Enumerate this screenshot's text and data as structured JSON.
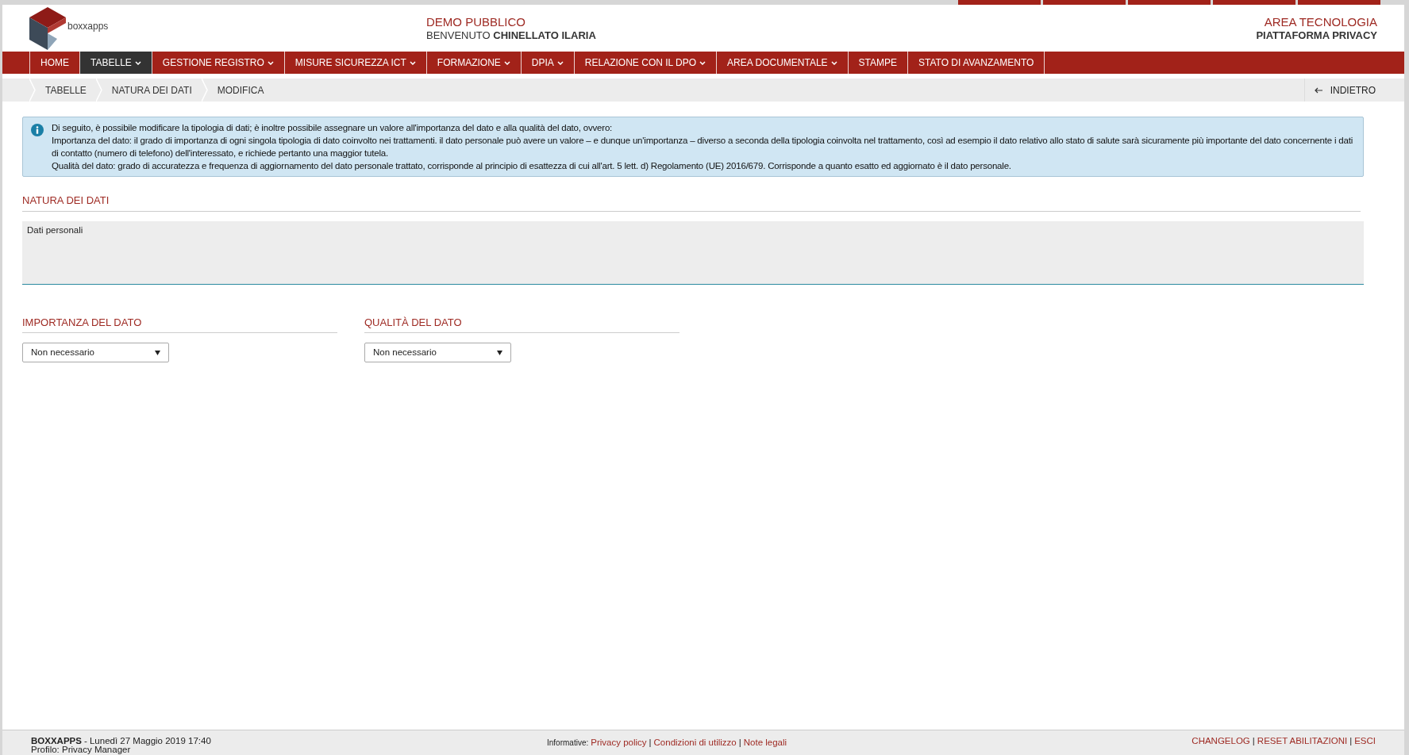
{
  "header": {
    "logo_text": "boxxapps",
    "demo_label": "DEMO PUBBLICO",
    "welcome_prefix": "BENVENUTO",
    "user_name": "CHINELLATO ILARIA",
    "area": "AREA TECNOLOGIA",
    "platform": "PIATTAFORMA PRIVACY"
  },
  "nav": [
    {
      "label": "HOME",
      "has_menu": false,
      "selected": false
    },
    {
      "label": "TABELLE",
      "has_menu": true,
      "selected": true
    },
    {
      "label": "GESTIONE REGISTRO",
      "has_menu": true,
      "selected": false
    },
    {
      "label": "MISURE SICUREZZA ICT",
      "has_menu": true,
      "selected": false
    },
    {
      "label": "FORMAZIONE",
      "has_menu": true,
      "selected": false
    },
    {
      "label": "DPIA",
      "has_menu": true,
      "selected": false
    },
    {
      "label": "RELAZIONE CON IL DPO",
      "has_menu": true,
      "selected": false
    },
    {
      "label": "AREA DOCUMENTALE",
      "has_menu": true,
      "selected": false
    },
    {
      "label": "STAMPE",
      "has_menu": false,
      "selected": false
    },
    {
      "label": "STATO DI AVANZAMENTO",
      "has_menu": false,
      "selected": false
    }
  ],
  "breadcrumb": [
    "TABELLE",
    "NATURA DEI DATI",
    "MODIFICA"
  ],
  "back_button": "INDIETRO",
  "info": [
    "Di seguito, è possibile modificare la tipologia di dati; è inoltre possibile assegnare un valore all'importanza del dato e alla qualità del dato, ovvero:",
    "Importanza del dato: il grado di importanza di ogni singola tipologia di dato coinvolto nei trattamenti.  il dato personale può avere un valore – e dunque un'importanza – diverso a seconda della tipologia coinvolta nel trattamento, così ad esempio il dato relativo allo stato di salute sarà sicuramente più importante del dato concernente i dati di contatto (numero di telefono) dell'interessato, e richiede pertanto una maggior tutela.",
    "Qualità del dato: grado di accuratezza e frequenza di aggiornamento del dato personale trattato, corrisponde al principio di esattezza di cui all'art. 5 lett. d) Regolamento (UE) 2016/679. Corrisponde a quanto esatto ed aggiornato è il dato personale."
  ],
  "nature_section": {
    "title": "NATURA DEI DATI",
    "value": "Dati personali"
  },
  "selects": [
    {
      "title": "IMPORTANZA DEL DATO",
      "value": "Non necessario"
    },
    {
      "title": "QUALITÀ DEL DATO",
      "value": "Non necessario"
    }
  ],
  "footer": {
    "separator": "|",
    "brand": "BOXXAPPS",
    "datetime": "- Lunedì 27 Maggio 2019 17:40",
    "profile": "Profilo: Privacy Manager",
    "informative_label": "Informative:",
    "links": [
      "Privacy policy",
      "Condizioni di utilizzo",
      "Note legali"
    ],
    "right_links": [
      "CHANGELOG",
      "RESET ABILITAZIONI",
      "ESCI"
    ]
  }
}
